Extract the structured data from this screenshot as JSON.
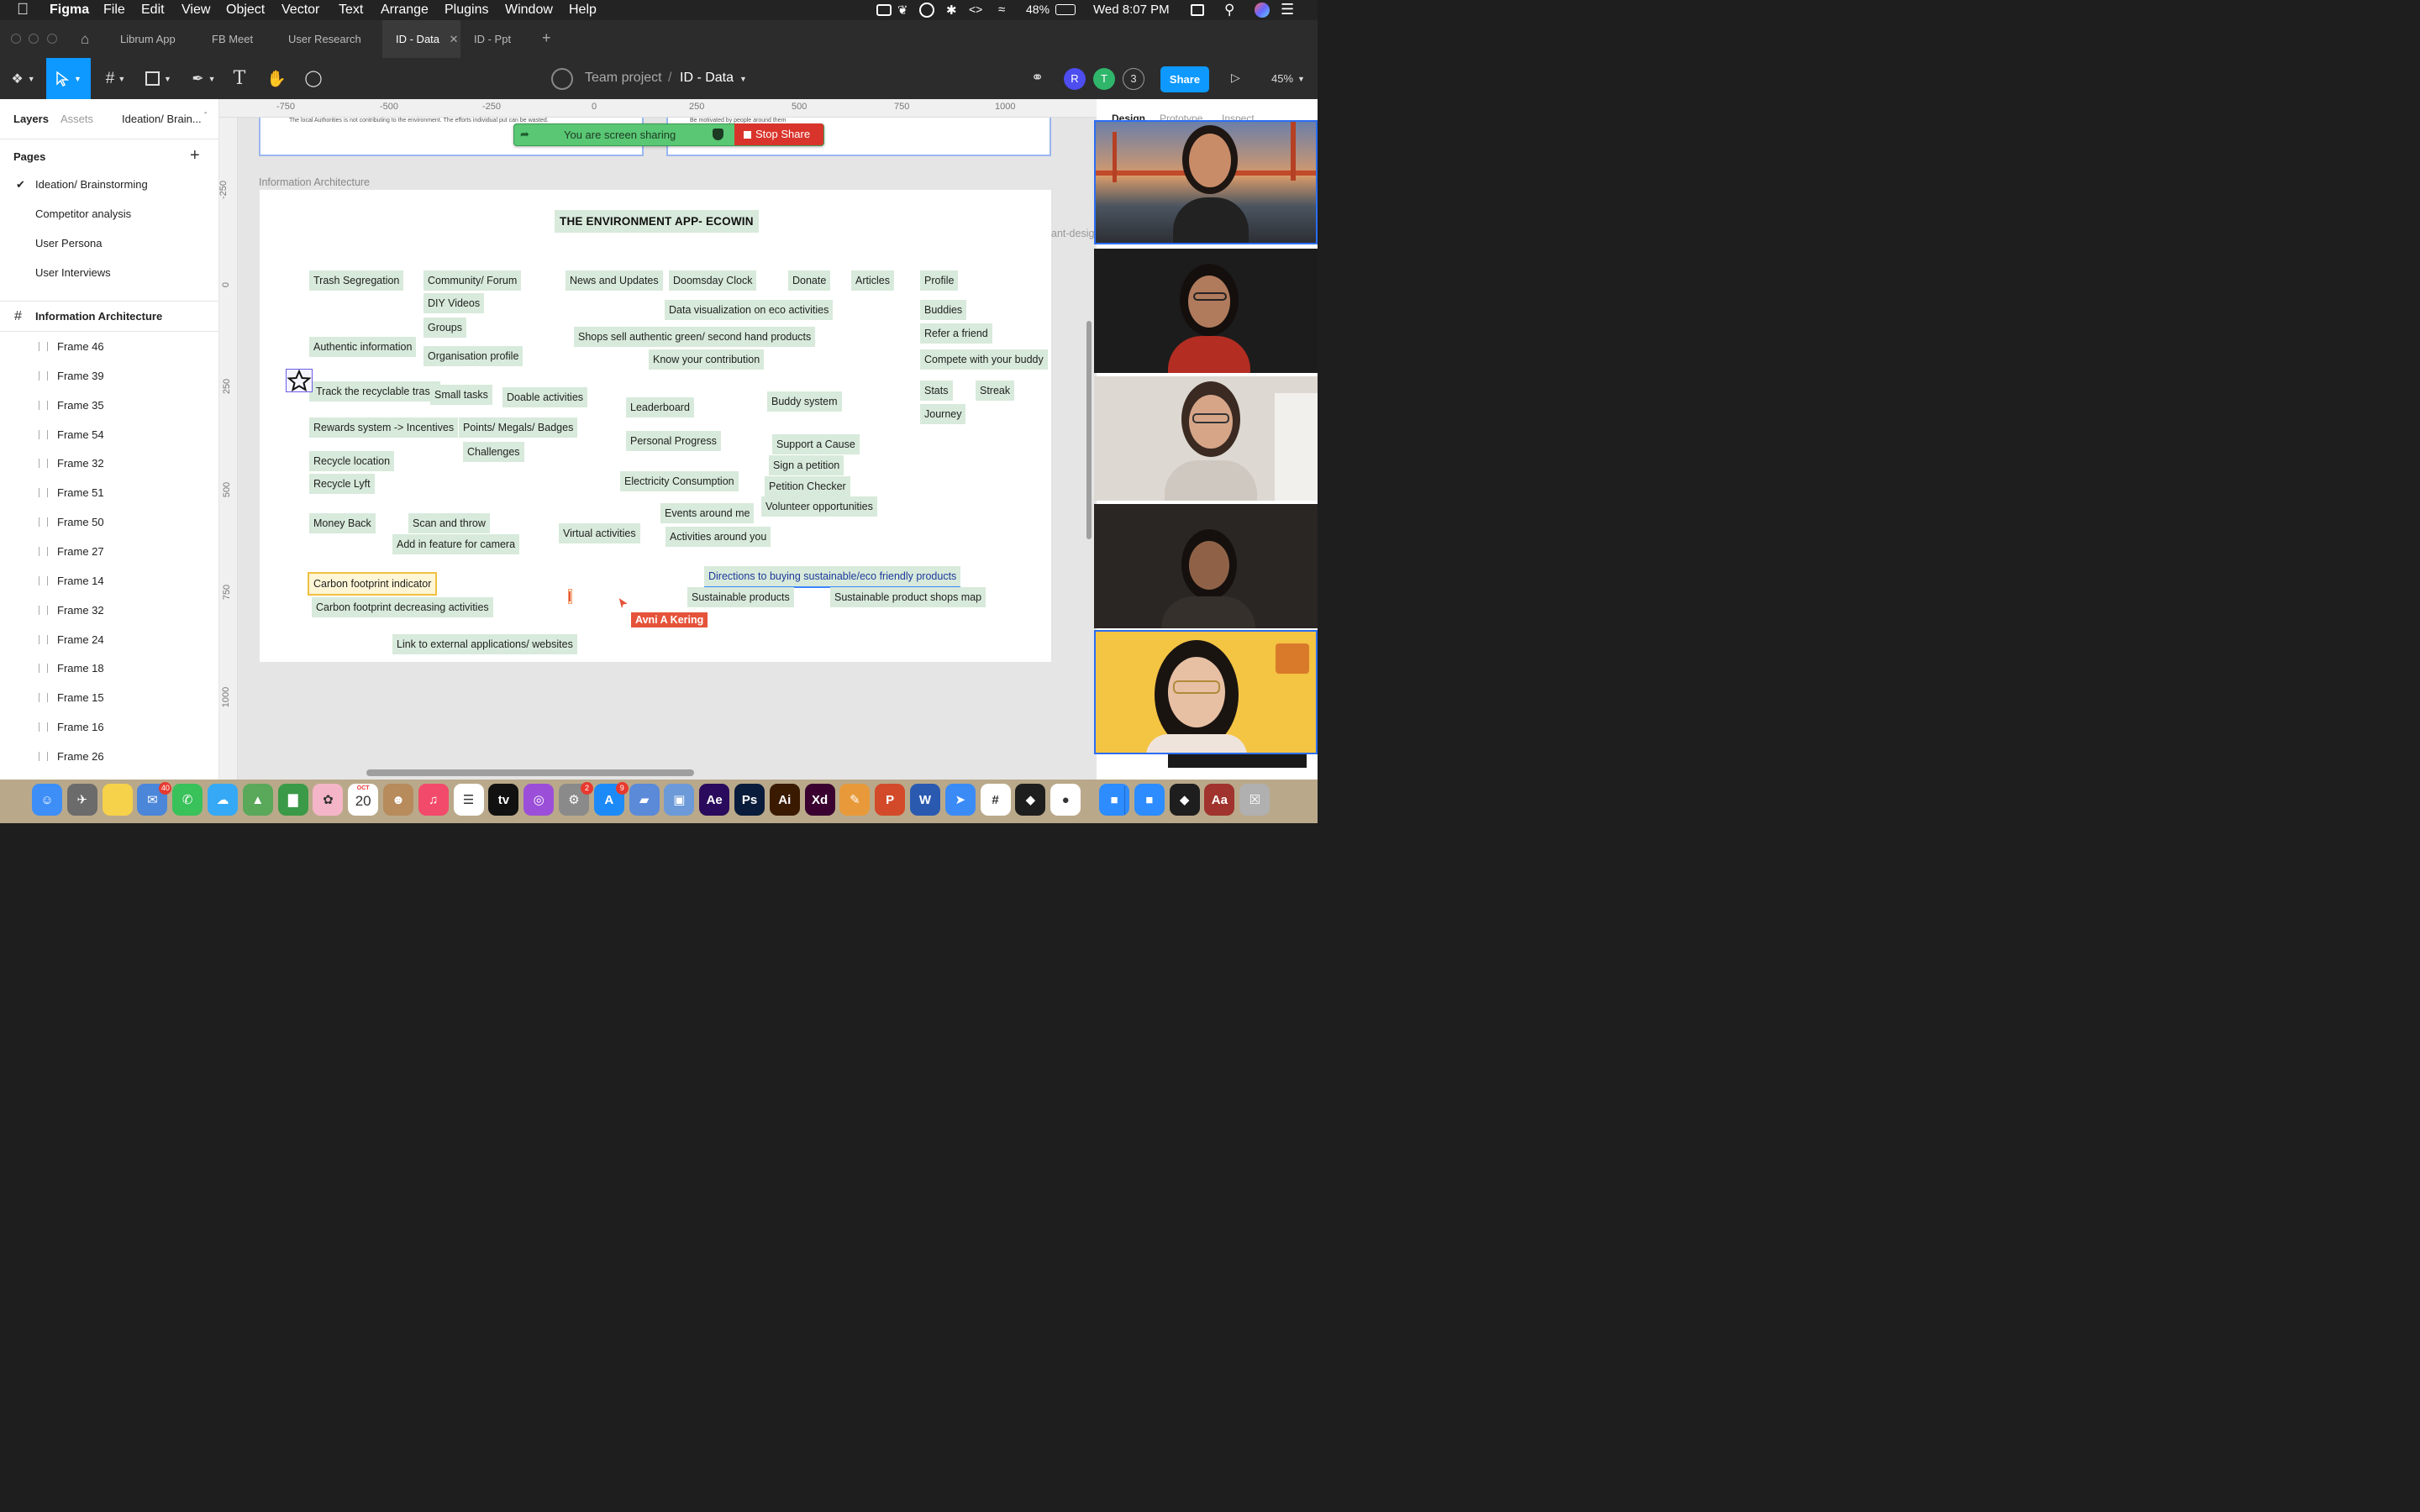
{
  "menubar": {
    "apple_icon": "apple-icon",
    "app_name": "Figma",
    "items": [
      "File",
      "Edit",
      "View",
      "Object",
      "Vector",
      "Text",
      "Arrange",
      "Plugins",
      "Window",
      "Help"
    ],
    "battery": "48%",
    "clock": "Wed 8:07 PM"
  },
  "tabs": {
    "items": [
      "Librum App",
      "FB Meet",
      "User Research",
      "ID - Data",
      "ID - Ppt"
    ],
    "active_index": 3,
    "add_icon": "plus-icon"
  },
  "toolbar": {
    "project": "Team project",
    "separator": "/",
    "file": "ID - Data",
    "avatars": [
      "R",
      "T",
      "3"
    ],
    "share_label": "Share",
    "zoom": "45%"
  },
  "left_panel": {
    "tabs": [
      "Layers",
      "Assets"
    ],
    "page_selector": "Ideation/ Brain...",
    "pages_title": "Pages",
    "pages": [
      "Ideation/ Brainstorming",
      "Competitor analysis",
      "User Persona",
      "User Interviews"
    ],
    "selected_page": "Ideation/ Brainstorming",
    "top_frame": "Information Architecture",
    "frames": [
      "Frame 46",
      "Frame 39",
      "Frame 35",
      "Frame 54",
      "Frame 32",
      "Frame 51",
      "Frame 50",
      "Frame 27",
      "Frame 14",
      "Frame 32",
      "Frame 24",
      "Frame 18",
      "Frame 15",
      "Frame 16",
      "Frame 26"
    ]
  },
  "rulers": {
    "top": [
      "-750",
      "-500",
      "-250",
      "0",
      "250",
      "500",
      "750",
      "1000"
    ],
    "left": [
      "-250",
      "0",
      "250",
      "500",
      "750",
      "1000"
    ]
  },
  "screen_share": {
    "message": "You are screen sharing",
    "stop_label": "Stop Share"
  },
  "canvas": {
    "top_note_left": "The local Authorities is not contributing to the environment. The efforts individual put can be wasted.",
    "top_note_right": "Be motivated by people around them",
    "frame_label": "Information Architecture",
    "side_clip": "ant-desig",
    "title": "THE ENVIRONMENT APP- ECOWIN",
    "chips": [
      "Trash Segregation",
      "Community/ Forum",
      "News and Updates",
      "Doomsday Clock",
      "Donate",
      "Articles",
      "Profile",
      "DIY Videos",
      "Data visualization on eco activities",
      "Buddies",
      "Groups",
      "Refer a friend",
      "Shops sell authentic green/ second hand products",
      "Authentic information",
      "Organisation profile",
      "Know your contribution",
      "Compete with your buddy",
      "Track the recyclable trash",
      "Small tasks",
      "Doable activities",
      "Stats",
      "Streak",
      "Leaderboard",
      "Buddy system",
      "Journey",
      "Rewards system -> Incentives",
      "Points/ Megals/ Badges",
      "Personal Progress",
      "Support a Cause",
      "Challenges",
      "Recycle location",
      "Sign a petition",
      "Electricity Consumption",
      "Petition Checker",
      "Recycle Lyft",
      "Volunteer opportunities",
      "Events around me",
      "Money Back",
      "Scan and throw",
      "Virtual activities",
      "Activities around you",
      "Add in feature for camera",
      "Directions to buying sustainable/eco friendly products",
      "Carbon footprint indicator",
      "Sustainable products",
      "Sustainable product shops map",
      "Carbon footprint decreasing activities",
      "Link to external applications/ websites"
    ],
    "cursor_user": "Avni A Kering"
  },
  "right_panel": {
    "tabs": [
      "Design",
      "Prototype",
      "Inspect"
    ]
  },
  "colors": {
    "accent": "#0d99ff",
    "chip_bg": "#d8eadb",
    "share_green": "#59c774",
    "stop_red": "#d9342b",
    "cursor_red": "#e5533a"
  },
  "dock": {
    "apps": [
      "Finder",
      "Launchpad",
      "Notes",
      "Mail",
      "FaceTime",
      "Messages",
      "Maps",
      "Numbers",
      "Photos",
      "Calendar",
      "Contacts",
      "Music",
      "Reminders",
      "TV",
      "Podcasts",
      "System Preferences",
      "App Store",
      "Keynote",
      "Preview",
      "Ae",
      "Ps",
      "Ai",
      "Xd",
      "Pages",
      "PowerPoint",
      "W",
      "Safari",
      "Slack",
      "Figma",
      "Chrome",
      "Zoom",
      "Zoom",
      "Figma",
      "Dictionary",
      "Trash"
    ],
    "calendar_month": "OCT",
    "calendar_day": "20",
    "badges": [
      "40",
      "2",
      "9"
    ]
  }
}
